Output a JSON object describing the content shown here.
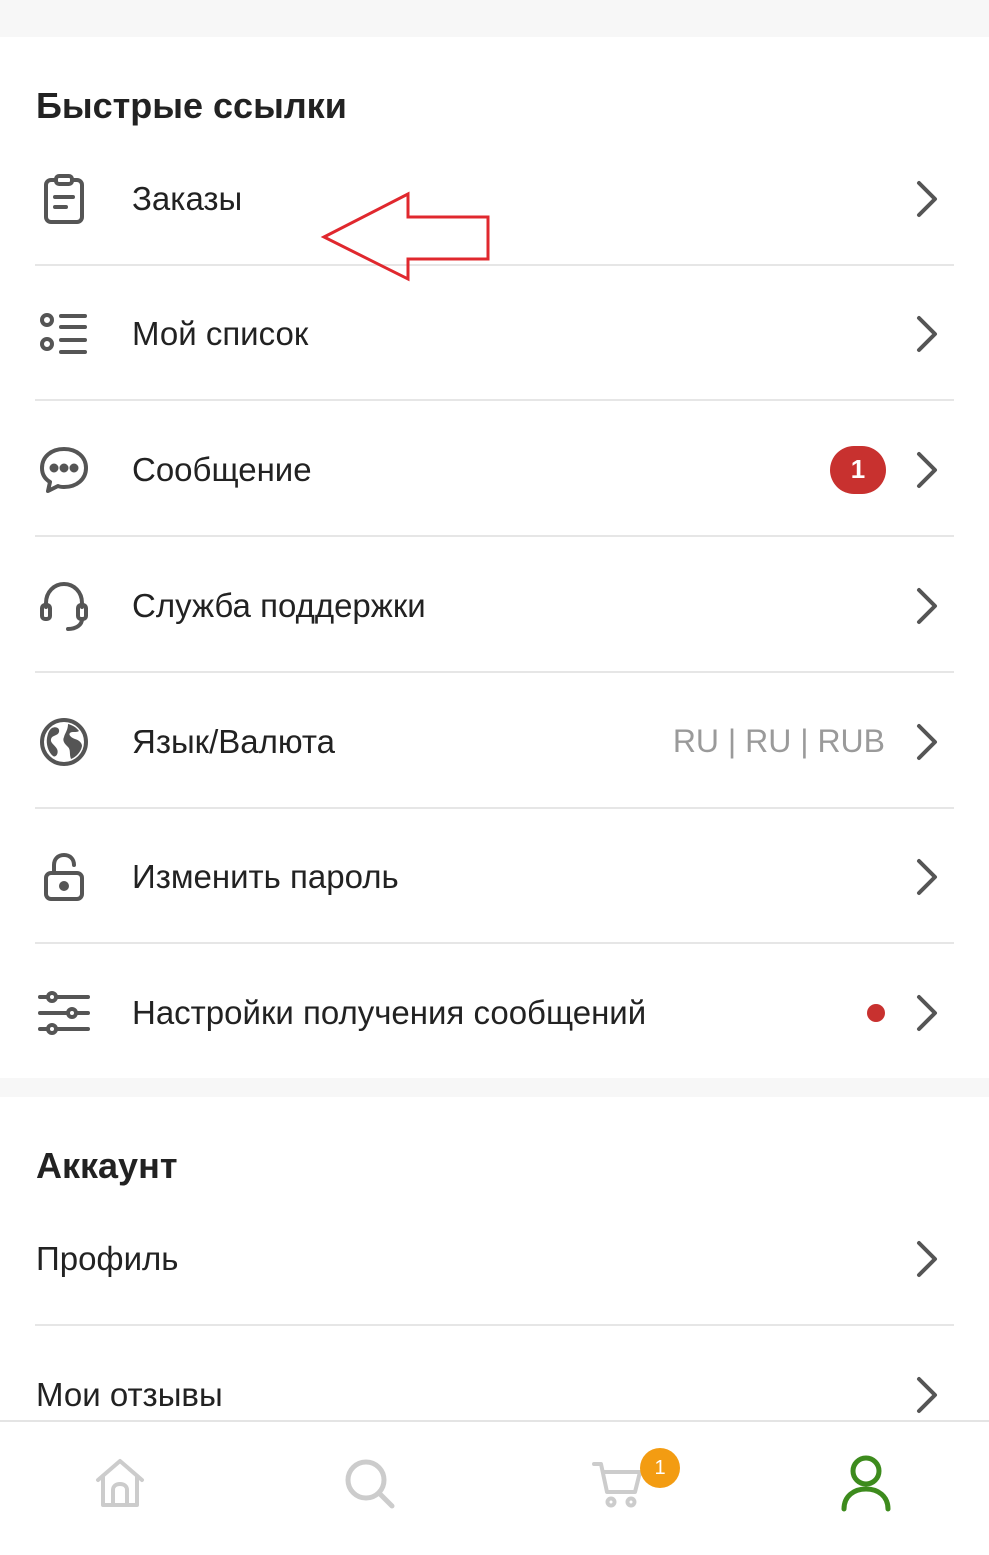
{
  "quick_links": {
    "title": "Быстрые ссылки",
    "items": [
      {
        "label": "Заказы",
        "icon": "clipboard-icon"
      },
      {
        "label": "Мой список",
        "icon": "list-icon"
      },
      {
        "label": "Сообщение",
        "icon": "chat-icon",
        "badge": "1"
      },
      {
        "label": "Служба поддержки",
        "icon": "headset-icon"
      },
      {
        "label": "Язык/Валюта",
        "icon": "globe-icon",
        "value": "RU | RU | RUB"
      },
      {
        "label": "Изменить пароль",
        "icon": "lock-icon"
      },
      {
        "label": "Настройки получения сообщений",
        "icon": "sliders-icon",
        "has_dot": true
      }
    ]
  },
  "account": {
    "title": "Аккаунт",
    "items": [
      {
        "label": "Профиль"
      },
      {
        "label": "Мои отзывы"
      }
    ]
  },
  "bottom_nav": {
    "items": [
      {
        "icon": "home-icon"
      },
      {
        "icon": "search-icon"
      },
      {
        "icon": "cart-icon",
        "badge": "1"
      },
      {
        "icon": "user-icon",
        "active": true
      }
    ]
  },
  "colors": {
    "badge_red": "#c8312f",
    "cart_badge_orange": "#f39c12",
    "active_green": "#3d8b1d",
    "icon_gray": "#555555",
    "nav_gray": "#cccccc",
    "annotation_red": "#e0282e"
  }
}
